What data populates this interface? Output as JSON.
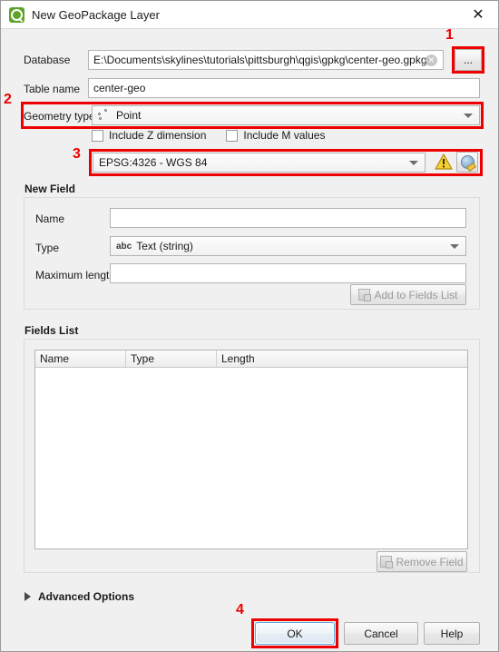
{
  "window": {
    "title": "New GeoPackage Layer",
    "logo_icon": "qgis-logo-icon",
    "close_icon": "close-icon"
  },
  "form": {
    "database": {
      "label": "Database",
      "value": "E:\\Documents\\skylines\\tutorials\\pittsburgh\\qgis\\gpkg\\center-geo.gpkg",
      "clear_icon": "clear-icon",
      "browse_label": "..."
    },
    "table_name": {
      "label": "Table name",
      "value": "center-geo"
    },
    "geometry_type": {
      "label": "Geometry type",
      "value": "Point",
      "icon": "point-geometry-icon"
    },
    "include_z": {
      "label": "Include Z dimension",
      "checked": false
    },
    "include_m": {
      "label": "Include M values",
      "checked": false
    },
    "crs": {
      "value": "EPSG:4326 - WGS 84",
      "warning_icon": "warning-triangle-icon",
      "select_icon": "globe-crs-icon"
    }
  },
  "new_field": {
    "title": "New Field",
    "name": {
      "label": "Name",
      "value": ""
    },
    "type": {
      "label": "Type",
      "value": "Text (string)",
      "type_marker": "abc"
    },
    "maximum_length": {
      "label": "Maximum length",
      "value": ""
    },
    "add_button": {
      "label": "Add to Fields List",
      "enabled": false,
      "icon": "add-field-icon"
    }
  },
  "fields_list": {
    "title": "Fields List",
    "columns": [
      "Name",
      "Type",
      "Length"
    ],
    "rows": [],
    "remove_button": {
      "label": "Remove Field",
      "enabled": false,
      "icon": "remove-field-icon"
    }
  },
  "advanced_options": {
    "label": "Advanced Options",
    "expanded": false,
    "icon": "chevron-right-icon"
  },
  "buttons": {
    "ok": "OK",
    "cancel": "Cancel",
    "help": "Help"
  },
  "annotations": [
    {
      "number": "1",
      "target": "browse-button"
    },
    {
      "number": "2",
      "target": "geometry-type-row"
    },
    {
      "number": "3",
      "target": "crs-row"
    },
    {
      "number": "4",
      "target": "ok-button"
    }
  ],
  "colors": {
    "annotation": "#ee0000",
    "brand_green": "#5ea32a",
    "dialog_bg": "#f0f0f0",
    "focus_blue": "#5ba7d8",
    "warning_yellow": "#f2c33c"
  }
}
